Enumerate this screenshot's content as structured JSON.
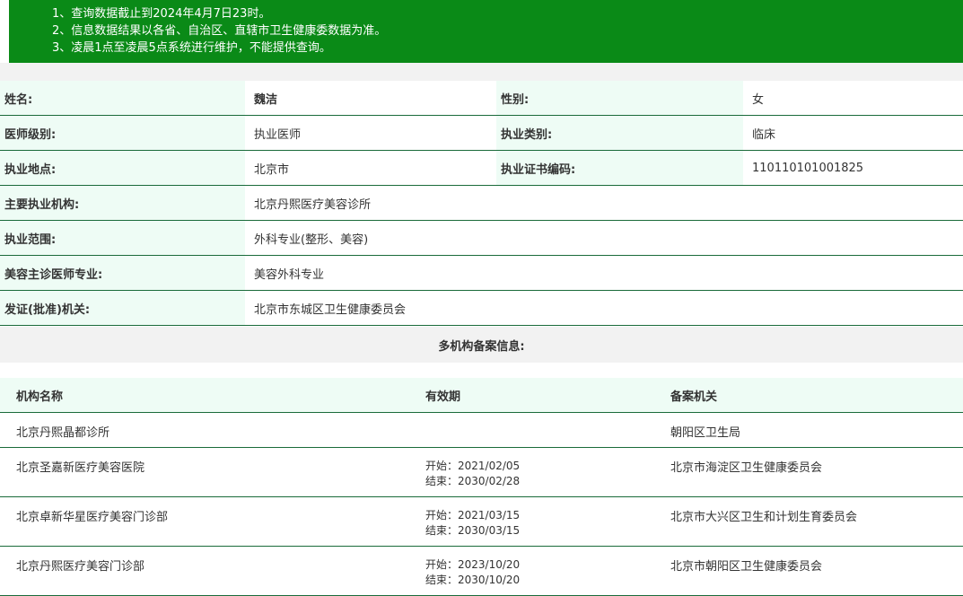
{
  "notice": {
    "lines": [
      "1、查询数据截止到2024年4月7日23时。",
      "2、信息数据结果以各省、自治区、直辖市卫生健康委数据为准。",
      "3、凌晨1点至凌晨5点系统进行维护，不能提供查询。"
    ]
  },
  "doctor": {
    "name_label": "姓名:",
    "name": "魏洁",
    "gender_label": "性别:",
    "gender": "女",
    "level_label": "医师级别:",
    "level": "执业医师",
    "category_label": "执业类别:",
    "category": "临床",
    "location_label": "执业地点:",
    "location": "北京市",
    "cert_label": "执业证书编码:",
    "cert": "110110101001825",
    "institution_label": "主要执业机构:",
    "institution": "北京丹熙医疗美容诊所",
    "scope_label": "执业范围:",
    "scope": "外科专业(整形、美容)",
    "specialty_label": "美容主诊医师专业:",
    "specialty": "美容外科专业",
    "issuer_label": "发证(批准)机关:",
    "issuer": "北京市东城区卫生健康委员会"
  },
  "multi": {
    "title": "多机构备案信息:",
    "headers": [
      "机构名称",
      "有效期",
      "备案机关"
    ],
    "rows": [
      {
        "name": "北京丹熙晶都诊所",
        "start": "",
        "end": "",
        "authority": "朝阳区卫生局"
      },
      {
        "name": "北京圣嘉新医疗美容医院",
        "start": "开始：2021/02/05",
        "end": "结束：2030/02/28",
        "authority": "北京市海淀区卫生健康委员会"
      },
      {
        "name": "北京卓新华星医疗美容门诊部",
        "start": "开始：2021/03/15",
        "end": "结束：2030/03/15",
        "authority": "北京市大兴区卫生和计划生育委员会"
      },
      {
        "name": "北京丹熙医疗美容门诊部",
        "start": "开始：2023/10/20",
        "end": "结束：2030/10/20",
        "authority": "北京市朝阳区卫生健康委员会"
      }
    ]
  }
}
